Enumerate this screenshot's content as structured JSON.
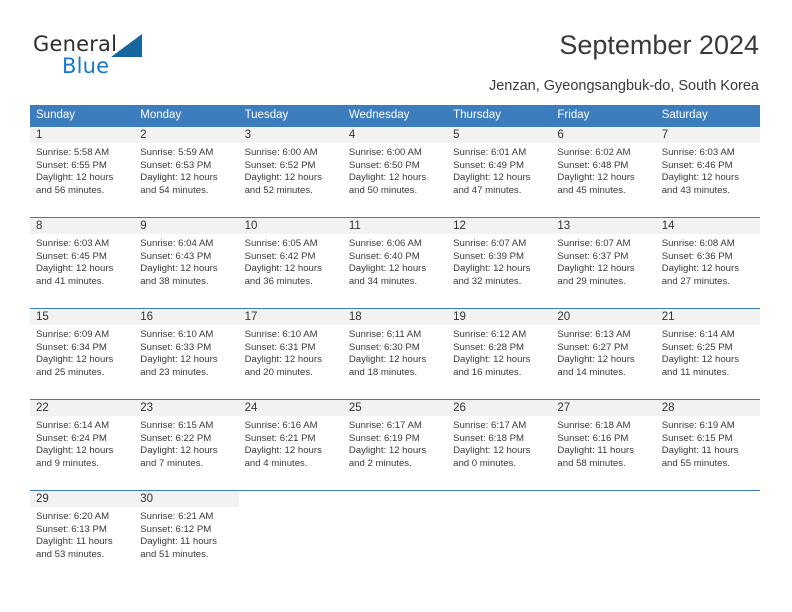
{
  "brand": {
    "name_top": "General",
    "name_bottom": "Blue",
    "accent_color": "#1878c8",
    "triangle_color": "#15659e"
  },
  "header": {
    "title": "September 2024",
    "subtitle": "Jenzan, Gyeongsangbuk-do, South Korea"
  },
  "calendar": {
    "header_background": "#3b7dbd",
    "daynum_background": "#f2f2f2",
    "weekday_headers": [
      "Sunday",
      "Monday",
      "Tuesday",
      "Wednesday",
      "Thursday",
      "Friday",
      "Saturday"
    ],
    "weeks": [
      [
        {
          "day": "1",
          "lines": [
            "Sunrise: 5:58 AM",
            "Sunset: 6:55 PM",
            "Daylight: 12 hours",
            "and 56 minutes."
          ]
        },
        {
          "day": "2",
          "lines": [
            "Sunrise: 5:59 AM",
            "Sunset: 6:53 PM",
            "Daylight: 12 hours",
            "and 54 minutes."
          ]
        },
        {
          "day": "3",
          "lines": [
            "Sunrise: 6:00 AM",
            "Sunset: 6:52 PM",
            "Daylight: 12 hours",
            "and 52 minutes."
          ]
        },
        {
          "day": "4",
          "lines": [
            "Sunrise: 6:00 AM",
            "Sunset: 6:50 PM",
            "Daylight: 12 hours",
            "and 50 minutes."
          ]
        },
        {
          "day": "5",
          "lines": [
            "Sunrise: 6:01 AM",
            "Sunset: 6:49 PM",
            "Daylight: 12 hours",
            "and 47 minutes."
          ]
        },
        {
          "day": "6",
          "lines": [
            "Sunrise: 6:02 AM",
            "Sunset: 6:48 PM",
            "Daylight: 12 hours",
            "and 45 minutes."
          ]
        },
        {
          "day": "7",
          "lines": [
            "Sunrise: 6:03 AM",
            "Sunset: 6:46 PM",
            "Daylight: 12 hours",
            "and 43 minutes."
          ]
        }
      ],
      [
        {
          "day": "8",
          "lines": [
            "Sunrise: 6:03 AM",
            "Sunset: 6:45 PM",
            "Daylight: 12 hours",
            "and 41 minutes."
          ]
        },
        {
          "day": "9",
          "lines": [
            "Sunrise: 6:04 AM",
            "Sunset: 6:43 PM",
            "Daylight: 12 hours",
            "and 38 minutes."
          ]
        },
        {
          "day": "10",
          "lines": [
            "Sunrise: 6:05 AM",
            "Sunset: 6:42 PM",
            "Daylight: 12 hours",
            "and 36 minutes."
          ]
        },
        {
          "day": "11",
          "lines": [
            "Sunrise: 6:06 AM",
            "Sunset: 6:40 PM",
            "Daylight: 12 hours",
            "and 34 minutes."
          ]
        },
        {
          "day": "12",
          "lines": [
            "Sunrise: 6:07 AM",
            "Sunset: 6:39 PM",
            "Daylight: 12 hours",
            "and 32 minutes."
          ]
        },
        {
          "day": "13",
          "lines": [
            "Sunrise: 6:07 AM",
            "Sunset: 6:37 PM",
            "Daylight: 12 hours",
            "and 29 minutes."
          ]
        },
        {
          "day": "14",
          "lines": [
            "Sunrise: 6:08 AM",
            "Sunset: 6:36 PM",
            "Daylight: 12 hours",
            "and 27 minutes."
          ]
        }
      ],
      [
        {
          "day": "15",
          "lines": [
            "Sunrise: 6:09 AM",
            "Sunset: 6:34 PM",
            "Daylight: 12 hours",
            "and 25 minutes."
          ]
        },
        {
          "day": "16",
          "lines": [
            "Sunrise: 6:10 AM",
            "Sunset: 6:33 PM",
            "Daylight: 12 hours",
            "and 23 minutes."
          ]
        },
        {
          "day": "17",
          "lines": [
            "Sunrise: 6:10 AM",
            "Sunset: 6:31 PM",
            "Daylight: 12 hours",
            "and 20 minutes."
          ]
        },
        {
          "day": "18",
          "lines": [
            "Sunrise: 6:11 AM",
            "Sunset: 6:30 PM",
            "Daylight: 12 hours",
            "and 18 minutes."
          ]
        },
        {
          "day": "19",
          "lines": [
            "Sunrise: 6:12 AM",
            "Sunset: 6:28 PM",
            "Daylight: 12 hours",
            "and 16 minutes."
          ]
        },
        {
          "day": "20",
          "lines": [
            "Sunrise: 6:13 AM",
            "Sunset: 6:27 PM",
            "Daylight: 12 hours",
            "and 14 minutes."
          ]
        },
        {
          "day": "21",
          "lines": [
            "Sunrise: 6:14 AM",
            "Sunset: 6:25 PM",
            "Daylight: 12 hours",
            "and 11 minutes."
          ]
        }
      ],
      [
        {
          "day": "22",
          "lines": [
            "Sunrise: 6:14 AM",
            "Sunset: 6:24 PM",
            "Daylight: 12 hours",
            "and 9 minutes."
          ]
        },
        {
          "day": "23",
          "lines": [
            "Sunrise: 6:15 AM",
            "Sunset: 6:22 PM",
            "Daylight: 12 hours",
            "and 7 minutes."
          ]
        },
        {
          "day": "24",
          "lines": [
            "Sunrise: 6:16 AM",
            "Sunset: 6:21 PM",
            "Daylight: 12 hours",
            "and 4 minutes."
          ]
        },
        {
          "day": "25",
          "lines": [
            "Sunrise: 6:17 AM",
            "Sunset: 6:19 PM",
            "Daylight: 12 hours",
            "and 2 minutes."
          ]
        },
        {
          "day": "26",
          "lines": [
            "Sunrise: 6:17 AM",
            "Sunset: 6:18 PM",
            "Daylight: 12 hours",
            "and 0 minutes."
          ]
        },
        {
          "day": "27",
          "lines": [
            "Sunrise: 6:18 AM",
            "Sunset: 6:16 PM",
            "Daylight: 11 hours",
            "and 58 minutes."
          ]
        },
        {
          "day": "28",
          "lines": [
            "Sunrise: 6:19 AM",
            "Sunset: 6:15 PM",
            "Daylight: 11 hours",
            "and 55 minutes."
          ]
        }
      ],
      [
        {
          "day": "29",
          "lines": [
            "Sunrise: 6:20 AM",
            "Sunset: 6:13 PM",
            "Daylight: 11 hours",
            "and 53 minutes."
          ]
        },
        {
          "day": "30",
          "lines": [
            "Sunrise: 6:21 AM",
            "Sunset: 6:12 PM",
            "Daylight: 11 hours",
            "and 51 minutes."
          ]
        },
        {
          "day": "",
          "lines": []
        },
        {
          "day": "",
          "lines": []
        },
        {
          "day": "",
          "lines": []
        },
        {
          "day": "",
          "lines": []
        },
        {
          "day": "",
          "lines": []
        }
      ]
    ]
  }
}
